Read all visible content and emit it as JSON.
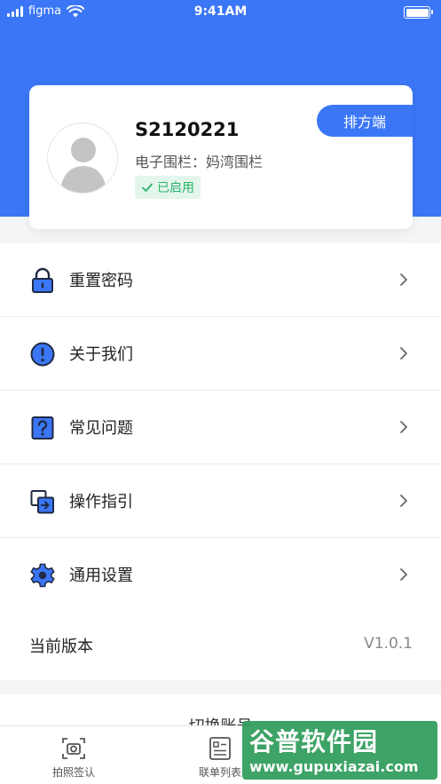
{
  "status_bar": {
    "carrier": "figma",
    "time": "9:41AM"
  },
  "profile": {
    "user_id": "S2120221",
    "fence_label": "电子围栏：",
    "fence_value": "妈湾围栏",
    "status": "已启用",
    "switch_button": "排方端"
  },
  "menu": {
    "items": [
      {
        "label": "重置密码",
        "icon": "lock-icon"
      },
      {
        "label": "关于我们",
        "icon": "info-icon"
      },
      {
        "label": "常见问题",
        "icon": "question-icon"
      },
      {
        "label": "操作指引",
        "icon": "guide-icon"
      },
      {
        "label": "通用设置",
        "icon": "gear-icon"
      }
    ]
  },
  "version": {
    "label": "当前版本",
    "value": "V1.0.1"
  },
  "logout": {
    "label": "切换账号"
  },
  "tabs": [
    {
      "label": "拍照签认",
      "icon": "camera-scan-icon"
    },
    {
      "label": "联单列表",
      "icon": "list-icon"
    }
  ],
  "watermark": {
    "title": "谷普软件园",
    "url": "www.gupuxiazai.com"
  },
  "colors": {
    "primary": "#3b76f6",
    "success": "#2ab26a",
    "watermark": "#2d9c5a"
  }
}
